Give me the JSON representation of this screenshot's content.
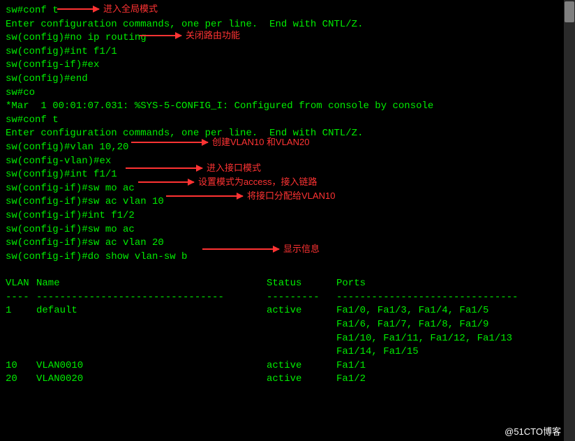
{
  "lines": {
    "l0": "sw#conf t",
    "l1": "Enter configuration commands, one per line.  End with CNTL/Z.",
    "l2": "sw(config)#no ip routing",
    "l3": "sw(config)#int f1/1",
    "l4": "sw(config-if)#ex",
    "l5": "sw(config)#end",
    "l6": "sw#co",
    "l7": "*Mar  1 00:01:07.031: %SYS-5-CONFIG_I: Configured from console by console",
    "l8": "sw#conf t",
    "l9": "Enter configuration commands, one per line.  End with CNTL/Z.",
    "l10": "sw(config)#vlan 10,20",
    "l11": "sw(config-vlan)#ex",
    "l12": "sw(config)#int f1/1",
    "l13": "sw(config-if)#sw mo ac",
    "l14": "sw(config-if)#sw ac vlan 10",
    "l15": "sw(config-if)#int f1/2",
    "l16": "sw(config-if)#sw mo ac",
    "l17": "sw(config-if)#sw ac vlan 20",
    "l18": "sw(config-if)#do show vlan-sw b"
  },
  "annotations": {
    "a0": "进入全局模式",
    "a1": "关闭路由功能",
    "a2": "创建VLAN10 和VLAN20",
    "a3": "进入接口模式",
    "a4": "设置模式为access，接入链路",
    "a5": "将接口分配给VLAN10",
    "a6": "显示信息"
  },
  "table": {
    "header": {
      "vlan": "VLAN",
      "name": "Name",
      "status": "Status",
      "ports": "Ports"
    },
    "sep": {
      "vlan": "----",
      "name": "--------------------------------",
      "status": "---------",
      "ports": "-------------------------------"
    },
    "rows": [
      {
        "vlan": "1",
        "name": "default",
        "status": "active",
        "ports": "Fa1/0, Fa1/3, Fa1/4, Fa1/5"
      },
      {
        "vlan": "",
        "name": "",
        "status": "",
        "ports": "Fa1/6, Fa1/7, Fa1/8, Fa1/9"
      },
      {
        "vlan": "",
        "name": "",
        "status": "",
        "ports": "Fa1/10, Fa1/11, Fa1/12, Fa1/13"
      },
      {
        "vlan": "",
        "name": "",
        "status": "",
        "ports": "Fa1/14, Fa1/15"
      },
      {
        "vlan": "10",
        "name": "VLAN0010",
        "status": "active",
        "ports": "Fa1/1"
      },
      {
        "vlan": "20",
        "name": "VLAN0020",
        "status": "active",
        "ports": "Fa1/2"
      }
    ]
  },
  "watermark": "@51CTO博客"
}
